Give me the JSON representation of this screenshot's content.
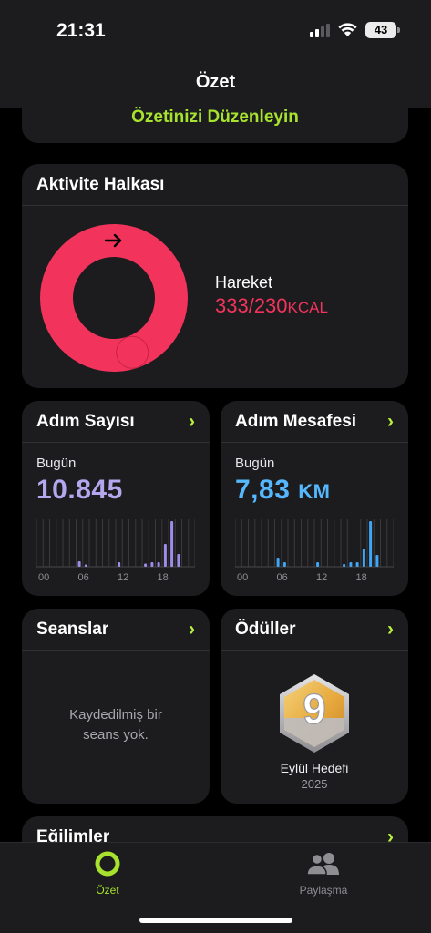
{
  "status": {
    "time": "21:31",
    "battery": "43"
  },
  "nav": {
    "title": "Özet"
  },
  "edit_link": "Özetinizi Düzenleyin",
  "activity": {
    "title": "Aktivite Halkası",
    "label": "Hareket",
    "value": "333/230",
    "unit": "KCAL",
    "progress": 1.448,
    "ring_color": "#f2345d"
  },
  "steps": {
    "title": "Adım Sayısı",
    "day_label": "Bugün",
    "value": "10.845",
    "value_color": "#b4a7ee",
    "ticks": [
      "00",
      "06",
      "12",
      "18"
    ],
    "hourly": [
      0,
      0,
      0,
      0,
      0,
      0,
      0.12,
      0.05,
      0,
      0,
      0,
      0,
      0.1,
      0,
      0,
      0,
      0.07,
      0.1,
      0.1,
      0.5,
      1.0,
      0.28,
      0,
      0
    ],
    "bar_color": "#9f8ce8"
  },
  "distance": {
    "title": "Adım Mesafesi",
    "day_label": "Bugün",
    "value": "7,83",
    "unit": "KM",
    "value_color": "#55b8ff",
    "ticks": [
      "00",
      "06",
      "12",
      "18"
    ],
    "hourly": [
      0,
      0,
      0,
      0,
      0,
      0,
      0.2,
      0.1,
      0,
      0,
      0,
      0,
      0.1,
      0,
      0,
      0,
      0.06,
      0.1,
      0.1,
      0.4,
      1.0,
      0.26,
      0,
      0
    ],
    "bar_color": "#3fa5f5"
  },
  "sessions": {
    "title": "Seanslar",
    "empty_line1": "Kaydedilmiş bir",
    "empty_line2": "seans yok."
  },
  "awards": {
    "title": "Ödüller",
    "badge_name": "Eylül Hedefi",
    "badge_year": "2025"
  },
  "trends": {
    "title": "Eğilimler"
  },
  "tabs": [
    {
      "label": "Özet",
      "icon": "activity-ring-icon",
      "color": "#a6e22e"
    },
    {
      "label": "Paylaşma",
      "icon": "people-icon",
      "color": "#8e8e93"
    }
  ]
}
